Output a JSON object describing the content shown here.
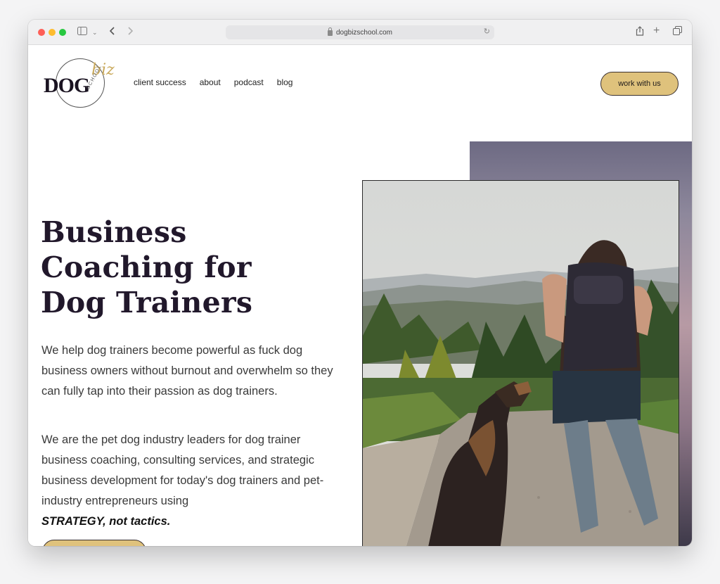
{
  "browser": {
    "url": "dogbizschool.com"
  },
  "logo": {
    "main": "DOG",
    "accent": "biz",
    "sub": "SCHOOL"
  },
  "nav": {
    "items": [
      "client success",
      "about",
      "podcast",
      "blog"
    ]
  },
  "header": {
    "cta_label": "work with us"
  },
  "hero": {
    "heading_lines": [
      "Business",
      "Coaching for",
      "Dog Trainers"
    ],
    "paragraph1": "We help dog trainers become powerful as fuck dog business owners without burnout and overwhelm so they can fully tap into their passion as dog trainers.",
    "paragraph2": "We are the pet dog industry leaders for dog trainer business coaching, consulting services, and strategic business development for today's dog trainers and pet-industry entrepreneurs using",
    "paragraph2_emphasis": "STRATEGY, not tactics."
  },
  "colors": {
    "accent": "#dfc27c",
    "heading": "#21182b",
    "body_text": "#3a3a3a"
  },
  "icons": [
    "sidebar-icon",
    "chevron-down-icon",
    "back-icon",
    "forward-icon",
    "lock-icon",
    "reload-icon",
    "share-icon",
    "new-tab-icon",
    "tabs-icon"
  ]
}
